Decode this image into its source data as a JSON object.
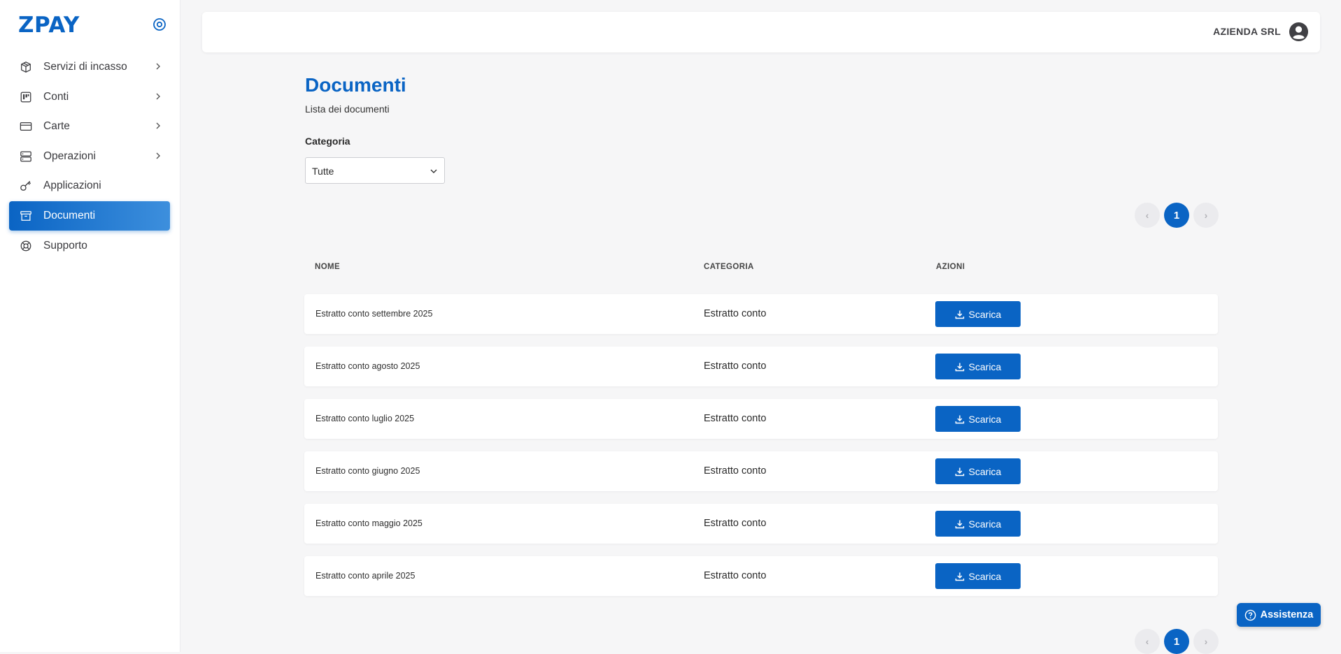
{
  "brand": {
    "logo": "ZPAY",
    "accent": "#0a64c4"
  },
  "sidebar": {
    "items": [
      {
        "label": "Servizi di incasso",
        "icon": "box-icon",
        "has_submenu": true,
        "active": false
      },
      {
        "label": "Conti",
        "icon": "columns-icon",
        "has_submenu": true,
        "active": false
      },
      {
        "label": "Carte",
        "icon": "credit-card-icon",
        "has_submenu": true,
        "active": false
      },
      {
        "label": "Operazioni",
        "icon": "server-icon",
        "has_submenu": true,
        "active": false
      },
      {
        "label": "Applicazioni",
        "icon": "key-icon",
        "has_submenu": false,
        "active": false
      },
      {
        "label": "Documenti",
        "icon": "archive-icon",
        "has_submenu": false,
        "active": true
      },
      {
        "label": "Supporto",
        "icon": "lifebuoy-icon",
        "has_submenu": false,
        "active": false
      }
    ]
  },
  "header": {
    "user_name": "AZIENDA SRL"
  },
  "main": {
    "title": "Documenti",
    "subtitle": "Lista dei documenti",
    "filter": {
      "label": "Categoria",
      "selected": "Tutte"
    },
    "pagination": {
      "current_page": "1"
    },
    "table": {
      "columns": [
        "NOME",
        "CATEGORIA",
        "AZIONI"
      ],
      "rows": [
        {
          "name": "Estratto conto settembre 2025",
          "category": "Estratto conto",
          "action": "Scarica"
        },
        {
          "name": "Estratto conto agosto 2025",
          "category": "Estratto conto",
          "action": "Scarica"
        },
        {
          "name": "Estratto conto luglio 2025",
          "category": "Estratto conto",
          "action": "Scarica"
        },
        {
          "name": "Estratto conto giugno 2025",
          "category": "Estratto conto",
          "action": "Scarica"
        },
        {
          "name": "Estratto conto maggio 2025",
          "category": "Estratto conto",
          "action": "Scarica"
        },
        {
          "name": "Estratto conto aprile 2025",
          "category": "Estratto conto",
          "action": "Scarica"
        }
      ]
    }
  },
  "help_button": {
    "label": "Assistenza"
  }
}
